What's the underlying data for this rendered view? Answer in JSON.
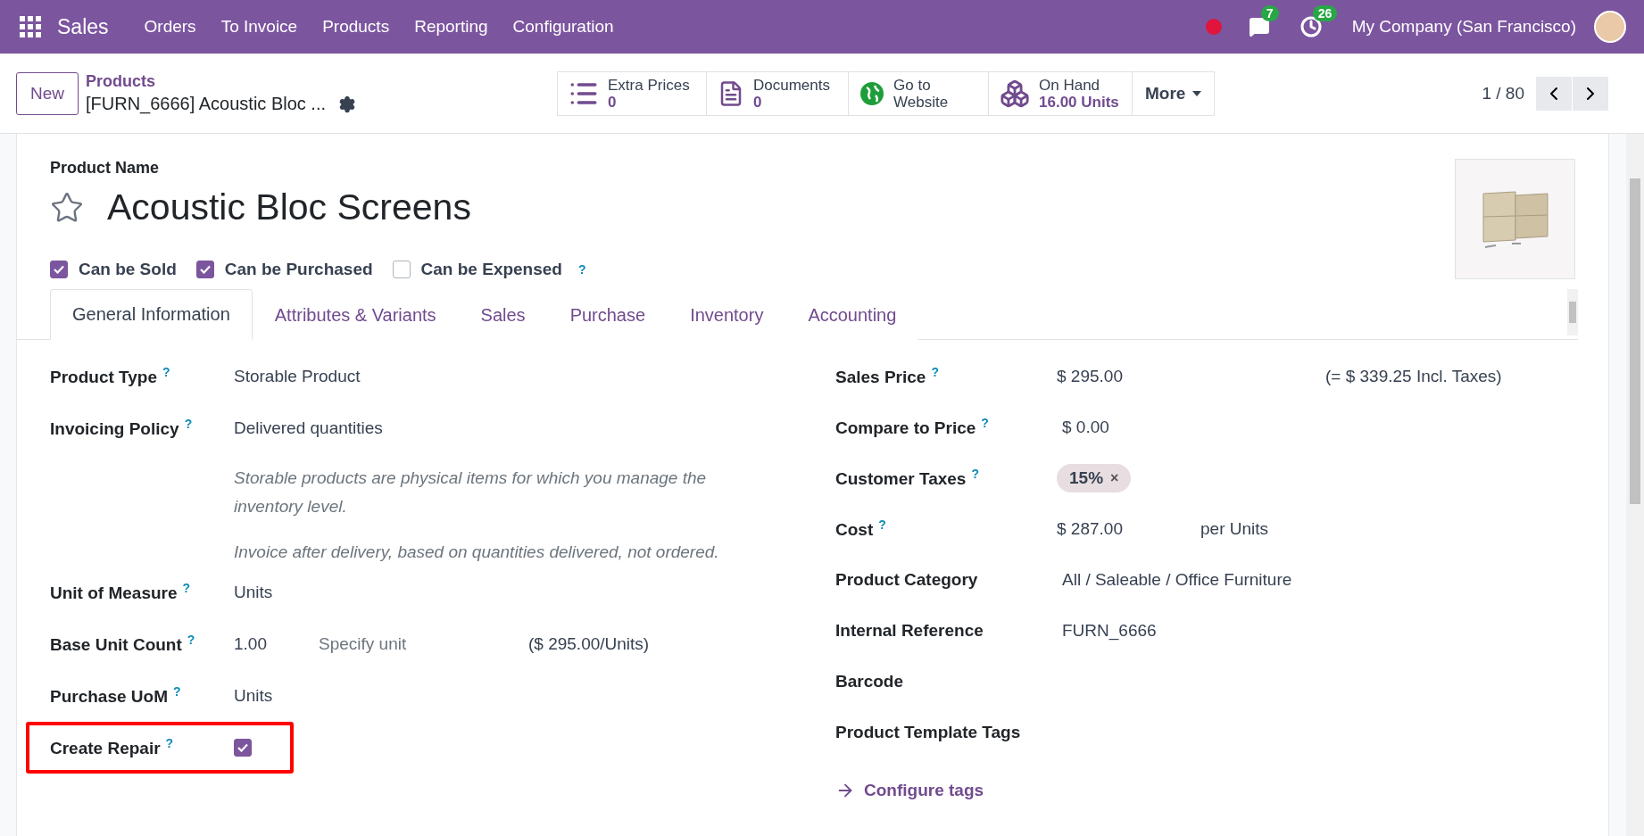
{
  "navbar": {
    "app_name": "Sales",
    "menus": [
      "Orders",
      "To Invoice",
      "Products",
      "Reporting",
      "Configuration"
    ],
    "chat_count": "7",
    "activity_count": "26",
    "company": "My Company (San Francisco)"
  },
  "control_panel": {
    "new_button": "New",
    "breadcrumb": {
      "parent": "Products",
      "current": "[FURN_6666] Acoustic Bloc ..."
    },
    "smart_buttons": [
      {
        "kind": "list",
        "label": "Extra Prices",
        "value": "0"
      },
      {
        "kind": "document",
        "label": "Documents",
        "value": "0"
      },
      {
        "kind": "website",
        "label": "Go to Website"
      },
      {
        "kind": "stock",
        "label": "On Hand",
        "value": "16.00 Units"
      }
    ],
    "more": "More",
    "pager": "1 / 80"
  },
  "product": {
    "name_label": "Product Name",
    "name": "Acoustic Bloc Screens",
    "starred": false,
    "options": [
      {
        "label": "Can be Sold",
        "checked": true
      },
      {
        "label": "Can be Purchased",
        "checked": true
      },
      {
        "label": "Can be Expensed",
        "checked": false,
        "help": "?"
      }
    ],
    "tabs": [
      {
        "label": "General Information",
        "selected": true
      },
      {
        "label": "Attributes & Variants",
        "selected": false
      },
      {
        "label": "Sales",
        "selected": false
      },
      {
        "label": "Purchase",
        "selected": false
      },
      {
        "label": "Inventory",
        "selected": false
      },
      {
        "label": "Accounting",
        "selected": false
      }
    ],
    "left_fields": [
      {
        "kind": "text",
        "label": "Product Type",
        "help": "?",
        "value": "Storable Product"
      },
      {
        "kind": "text",
        "label": "Invoicing Policy",
        "help": "?",
        "value": "Delivered quantities"
      },
      {
        "kind": "note",
        "text": "Storable products are physical items for which you manage the inventory level."
      },
      {
        "kind": "note",
        "text": "Invoice after delivery, based on quantities delivered, not ordered."
      },
      {
        "kind": "text",
        "label": "Unit of Measure",
        "help": "?",
        "value": "Units"
      },
      {
        "kind": "unit_count",
        "label": "Base Unit Count",
        "help": "?",
        "value": "1.00",
        "placeholder": "Specify unit",
        "extra": "($ 295.00/Units)"
      },
      {
        "kind": "text",
        "label": "Purchase UoM",
        "help": "?",
        "value": "Units"
      },
      {
        "kind": "checkbox",
        "label": "Create Repair",
        "help": "?",
        "checked": true,
        "highlighted": true
      }
    ],
    "right_fields": [
      {
        "kind": "price",
        "label": "Sales Price",
        "help": "?",
        "value": "$ 295.00",
        "extra": "(= $ 339.25 Incl. Taxes)"
      },
      {
        "kind": "text",
        "label": "Compare to Price",
        "help": "?",
        "value": "$ 0.00"
      },
      {
        "kind": "tags",
        "label": "Customer Taxes",
        "help": "?",
        "tags": [
          {
            "label": "15%",
            "remove": "×"
          }
        ]
      },
      {
        "kind": "cost",
        "label": "Cost",
        "help": "?",
        "value": "$ 287.00",
        "extra": "per Units"
      },
      {
        "kind": "text",
        "label": "Product Category",
        "value": "All / Saleable / Office Furniture"
      },
      {
        "kind": "text",
        "label": "Internal Reference",
        "value": "FURN_6666"
      },
      {
        "kind": "text",
        "label": "Barcode"
      },
      {
        "kind": "text",
        "label": "Product Template Tags"
      }
    ],
    "configure_link": "Configure tags"
  }
}
